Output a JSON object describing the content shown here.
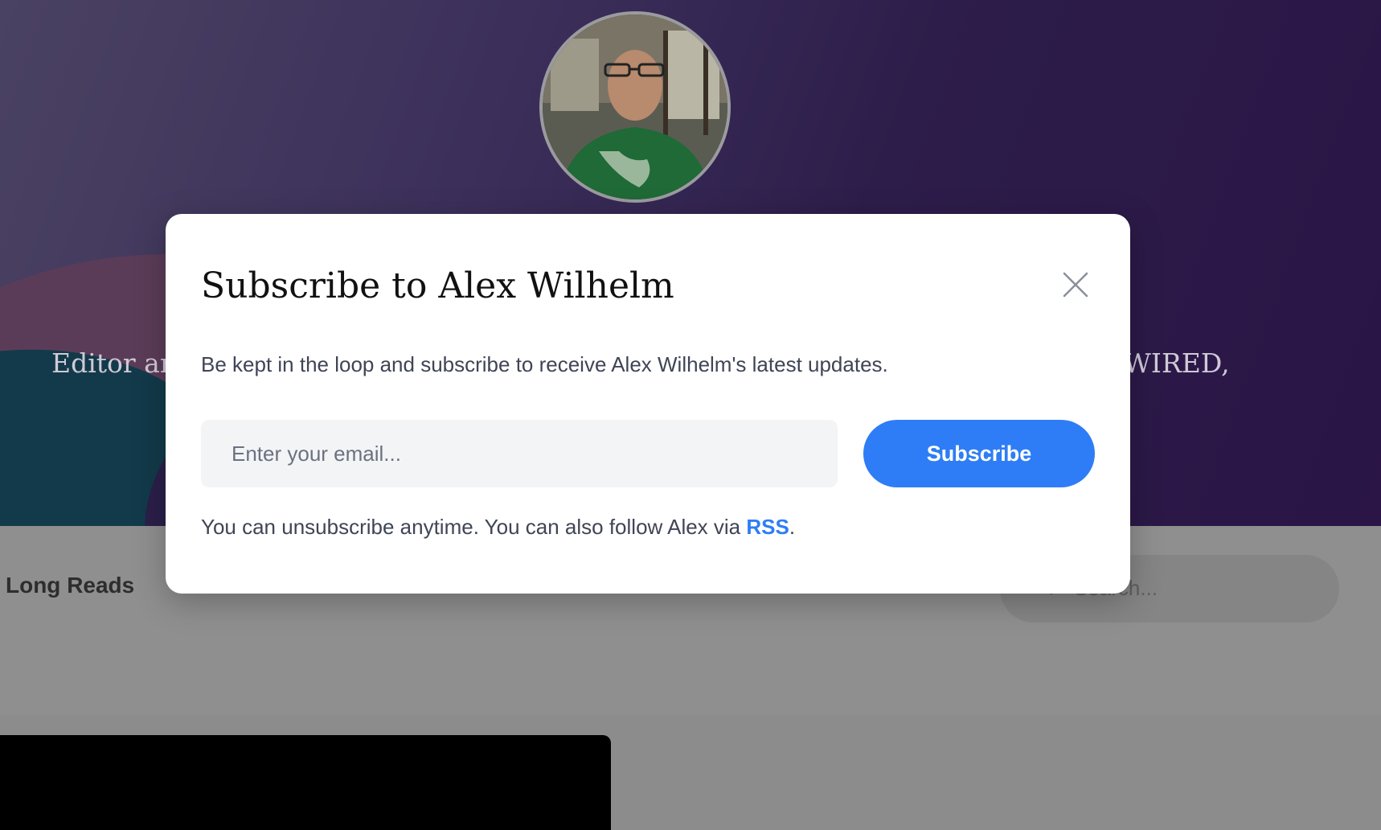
{
  "hero": {
    "bio_left": "Editor ar",
    "bio_right": "WIRED,"
  },
  "nav": {
    "long_reads_label": "Long Reads",
    "search_placeholder": "Search..."
  },
  "modal": {
    "title": "Subscribe to Alex Wilhelm",
    "description": "Be kept in the loop and subscribe to receive Alex Wilhelm's latest updates.",
    "email_placeholder": "Enter your email...",
    "subscribe_label": "Subscribe",
    "footnote_prefix": "You can unsubscribe anytime. You can also follow Alex via ",
    "rss_label": "RSS",
    "footnote_suffix": "."
  },
  "colors": {
    "accent": "#2e7df6",
    "hero_purple": "#2d1d4a",
    "modal_bg": "#ffffff"
  },
  "icons": {
    "close": "close-icon",
    "search": "search-icon",
    "avatar": "avatar"
  }
}
